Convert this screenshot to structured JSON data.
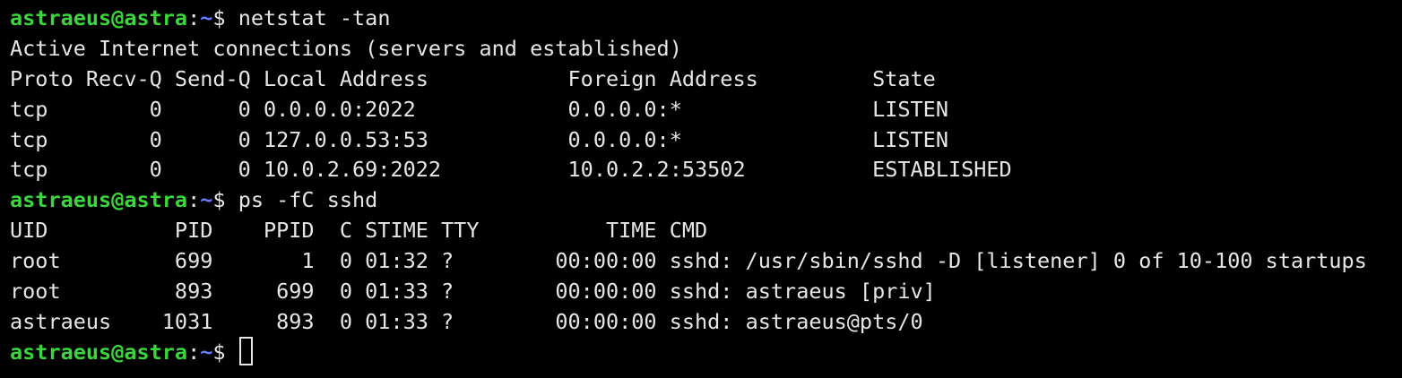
{
  "colors": {
    "background": "#000000",
    "foreground": "#e6e6e6",
    "prompt_user": "#3bd63b",
    "prompt_path": "#6b7cff"
  },
  "prompt": {
    "userhost": "astraeus@astra",
    "sep": ":",
    "path": "~",
    "symbol": "$ "
  },
  "commands": {
    "netstat": "netstat -tan",
    "ps": "ps -fC sshd"
  },
  "netstat_output": {
    "title": "Active Internet connections (servers and established)",
    "header": "Proto Recv-Q Send-Q Local Address           Foreign Address         State",
    "rows": [
      "tcp        0      0 0.0.0.0:2022            0.0.0.0:*               LISTEN",
      "tcp        0      0 127.0.0.53:53           0.0.0.0:*               LISTEN",
      "tcp        0      0 10.0.2.69:2022          10.0.2.2:53502          ESTABLISHED"
    ]
  },
  "ps_output": {
    "header": "UID          PID    PPID  C STIME TTY          TIME CMD",
    "rows": [
      "root         699       1  0 01:32 ?        00:00:00 sshd: /usr/sbin/sshd -D [listener] 0 of 10-100 startups",
      "root         893     699  0 01:33 ?        00:00:00 sshd: astraeus [priv]",
      "astraeus    1031     893  0 01:33 ?        00:00:00 sshd: astraeus@pts/0"
    ]
  },
  "cursor_icon": "block-cursor-hollow"
}
